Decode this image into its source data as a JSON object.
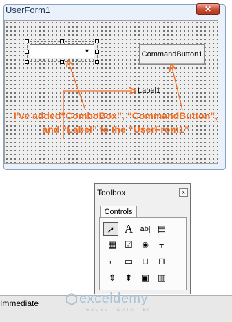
{
  "userform": {
    "title": "UserForm1",
    "close_symbol": "✕",
    "command_button_label": "CommandButton1",
    "label_text": "Label1"
  },
  "annotation": {
    "line1": "I’ve added“ComboBox”, “CommandButton”,",
    "line2": "and “Label” to the “UserFrom1”",
    "color": "#f26b21"
  },
  "toolbox": {
    "title": "Toolbox",
    "close_symbol": "x",
    "tab_label": "Controls",
    "tools": [
      {
        "name": "select-objects-icon",
        "glyph": "➚"
      },
      {
        "name": "label-tool-icon",
        "glyph": "A"
      },
      {
        "name": "textbox-tool-icon",
        "glyph": "ab|"
      },
      {
        "name": "combobox-tool-icon",
        "glyph": "▤"
      },
      {
        "name": "listbox-tool-icon",
        "glyph": "▦"
      },
      {
        "name": "checkbox-tool-icon",
        "glyph": "☑"
      },
      {
        "name": "optionbutton-tool-icon",
        "glyph": "◉"
      },
      {
        "name": "togglebutton-tool-icon",
        "glyph": "⫟"
      },
      {
        "name": "frame-tool-icon",
        "glyph": "⌐"
      },
      {
        "name": "commandbutton-tool-icon",
        "glyph": "▭"
      },
      {
        "name": "tabstrip-tool-icon",
        "glyph": "⊔"
      },
      {
        "name": "multipage-tool-icon",
        "glyph": "⊓"
      },
      {
        "name": "scrollbar-tool-icon",
        "glyph": "⇕"
      },
      {
        "name": "spinbutton-tool-icon",
        "glyph": "⬍"
      },
      {
        "name": "image-tool-icon",
        "glyph": "▣"
      },
      {
        "name": "refedit-tool-icon",
        "glyph": "▥"
      }
    ]
  },
  "bottom": {
    "immediate_label": "Immediate",
    "brand_name": "exceldemy",
    "brand_tagline": "EXCEL · DATA · BI"
  }
}
